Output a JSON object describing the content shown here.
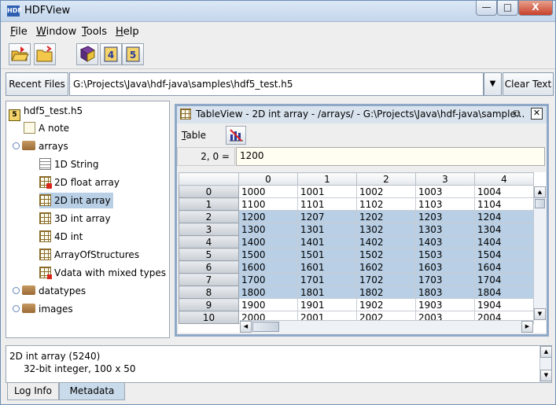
{
  "window": {
    "title": "HDFView",
    "icon": "HDF",
    "minimize": "—",
    "maximize": "□",
    "close": "X"
  },
  "menubar": [
    {
      "pre": "",
      "ul": "F",
      "post": "ile"
    },
    {
      "pre": "",
      "ul": "W",
      "post": "indow"
    },
    {
      "pre": "",
      "ul": "T",
      "post": "ools"
    },
    {
      "pre": "",
      "ul": "H",
      "post": "elp"
    }
  ],
  "recent": {
    "label": "Recent Files",
    "path": "G:\\Projects\\Java\\hdf-java\\samples\\hdf5_test.h5",
    "clear": "Clear Text"
  },
  "tree": [
    {
      "label": "hdf5_test.h5",
      "icon": "h5-file-icon",
      "badge": "5"
    },
    {
      "label": "A note"
    },
    {
      "label": "arrays"
    },
    {
      "label": "1D String"
    },
    {
      "label": "2D float array"
    },
    {
      "label": "2D int array"
    },
    {
      "label": "3D int array"
    },
    {
      "label": "4D int"
    },
    {
      "label": "ArrayOfStructures"
    },
    {
      "label": "Vdata with mixed types"
    },
    {
      "label": "datatypes"
    },
    {
      "label": "images"
    }
  ],
  "tableview": {
    "title": "TableView  -  2D int array  -  /arrays/  -  G:\\Projects\\Java\\hdf-java\\sample...",
    "menu_pre": "",
    "menu_ul": "T",
    "menu_post": "able",
    "cell_ref": "2, 0  =",
    "cell_value": "1200",
    "columns": [
      "0",
      "1",
      "2",
      "3",
      "4"
    ],
    "rows": [
      {
        "idx": "0",
        "vals": [
          "1000",
          "1001",
          "1002",
          "1003",
          "1004"
        ],
        "sel": false
      },
      {
        "idx": "1",
        "vals": [
          "1100",
          "1101",
          "1102",
          "1103",
          "1104"
        ],
        "sel": false
      },
      {
        "idx": "2",
        "vals": [
          "1200",
          "1207",
          "1202",
          "1203",
          "1204"
        ],
        "sel": true
      },
      {
        "idx": "3",
        "vals": [
          "1300",
          "1301",
          "1302",
          "1303",
          "1304"
        ],
        "sel": true
      },
      {
        "idx": "4",
        "vals": [
          "1400",
          "1401",
          "1402",
          "1403",
          "1404"
        ],
        "sel": true
      },
      {
        "idx": "5",
        "vals": [
          "1500",
          "1501",
          "1502",
          "1503",
          "1504"
        ],
        "sel": true
      },
      {
        "idx": "6",
        "vals": [
          "1600",
          "1601",
          "1602",
          "1603",
          "1604"
        ],
        "sel": true
      },
      {
        "idx": "7",
        "vals": [
          "1700",
          "1701",
          "1702",
          "1703",
          "1704"
        ],
        "sel": true
      },
      {
        "idx": "8",
        "vals": [
          "1800",
          "1801",
          "1802",
          "1803",
          "1804"
        ],
        "sel": true
      },
      {
        "idx": "9",
        "vals": [
          "1900",
          "1901",
          "1902",
          "1903",
          "1904"
        ],
        "sel": false
      },
      {
        "idx": "10",
        "vals": [
          "2000",
          "2001",
          "2002",
          "2003",
          "2004"
        ],
        "sel": false
      }
    ]
  },
  "info": {
    "line1": "2D int array (5240)",
    "line2": "32-bit integer,    100 x 50"
  },
  "tabs": [
    "Log Info",
    "Metadata"
  ]
}
